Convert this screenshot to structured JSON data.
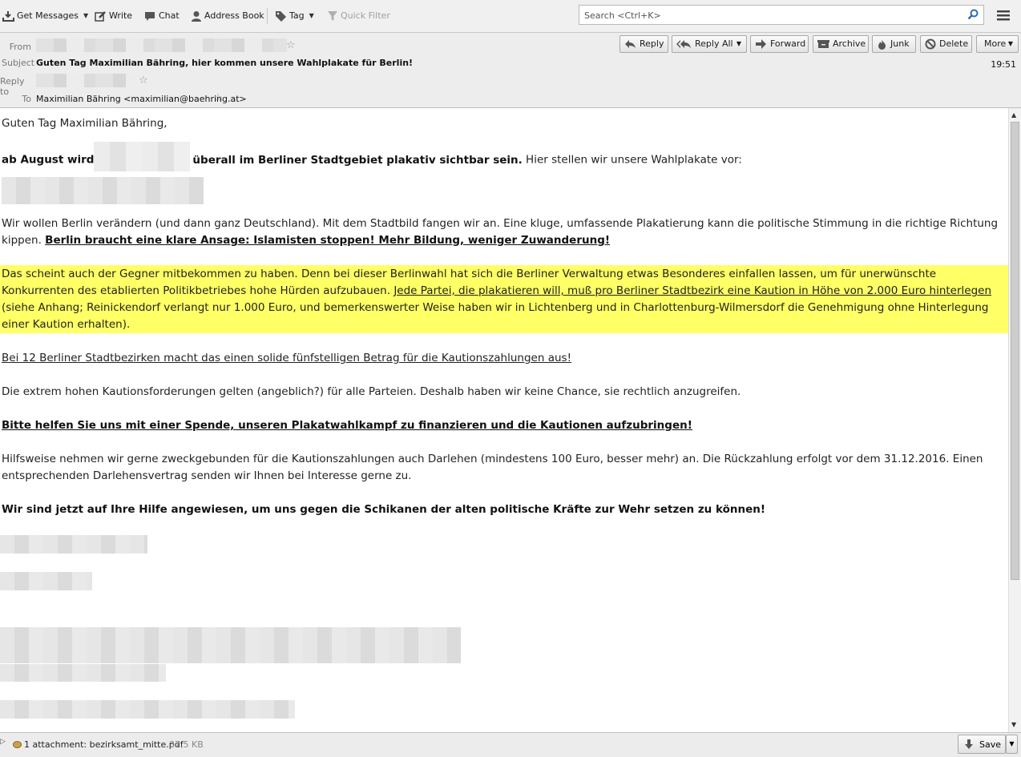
{
  "toolbar": {
    "get_messages": "Get Messages",
    "write": "Write",
    "chat": "Chat",
    "address_book": "Address Book",
    "tag": "Tag",
    "quick_filter": "Quick Filter",
    "search_placeholder": "Search <Ctrl+K>"
  },
  "header": {
    "from_label": "From",
    "subject_label": "Subject",
    "subject": "Guten Tag Maximilian Bähring, hier kommen unsere Wahlplakate für Berlin!",
    "reply_to_label": "Reply to",
    "to_label": "To",
    "to_value": "Maximilian Bähring <maximilian@baehring.at>",
    "time": "19:51",
    "buttons": {
      "reply": "Reply",
      "reply_all": "Reply All",
      "forward": "Forward",
      "archive": "Archive",
      "junk": "Junk",
      "delete": "Delete",
      "more": "More"
    }
  },
  "body": {
    "greeting": "Guten Tag Maximilian Bähring,",
    "p1_bold_a": "ab August wird",
    "p1_bold_b": "überall im Berliner Stadtgebiet plakativ sichtbar sein.",
    "p1_rest": " Hier stellen wir unsere Wahlplakate vor:",
    "p2_text": "Wir wollen Berlin verändern (und dann ganz Deutschland). Mit dem Stadtbild fangen wir an. Eine kluge, umfassende Plakatierung kann die politische Stimmung in die richtige Richtung kippen. ",
    "p2_bold_u": "Berlin braucht eine klare Ansage: Islamisten stoppen! Mehr Bildung, weniger Zuwanderung!",
    "p3_text": "Das scheint auch der Gegner mitbekommen zu haben. Denn bei dieser Berlinwahl hat sich die Berliner Verwaltung etwas Besonderes einfallen lassen, um für unerwünschte Konkurrenten des etablierten Politikbetriebes hohe Hürden aufzubauen. ",
    "p3_underlined": "Jede Partei, die plakatieren will, muß pro Berliner Stadtbezirk eine Kaution in Höhe von 2.000 Euro hinterlegen",
    "p3_rest": " (siehe Anhang; Reinickendorf verlangt nur 1.000 Euro, und bemerkenswerter Weise haben wir in Lichtenberg und in Charlottenburg-Wilmersdorf die Genehmigung ohne Hinterlegung einer Kaution erhalten).",
    "p4_underlined": "Bei 12 Berliner Stadtbezirken macht das einen solide fünfstelligen Betrag für die Kautionszahlungen aus!",
    "p5": "Die extrem hohen Kautionsforderungen gelten (angeblich?) für alle Parteien. Deshalb haben wir keine Chance, sie rechtlich anzugreifen.",
    "p6_bold_u": "Bitte helfen Sie uns mit einer Spende, unseren Plakatwahlkampf zu finanzieren und die Kautionen aufzubringen!",
    "p7": "Hilfsweise nehmen wir gerne zweckgebunden für die Kautionszahlungen auch Darlehen (mindestens 100 Euro, besser mehr) an. Die Rückzahlung erfolgt vor dem 31.12.2016. Einen entsprechenden Darlehensvertrag senden wir Ihnen bei Interesse gerne zu.",
    "p8_bold": "Wir sind jetzt auf Ihre Hilfe angewiesen, um uns gegen die Schikanen der alten politische Kräfte zur Wehr setzen zu können!"
  },
  "attachment": {
    "label": "1 attachment: bezirksamt_mitte.pdf",
    "size": "37,5 KB",
    "save": "Save"
  },
  "colors": {
    "highlight": "#ffff66",
    "toolbar_bg": "#f0f0f0",
    "header_bg": "#ededed"
  }
}
